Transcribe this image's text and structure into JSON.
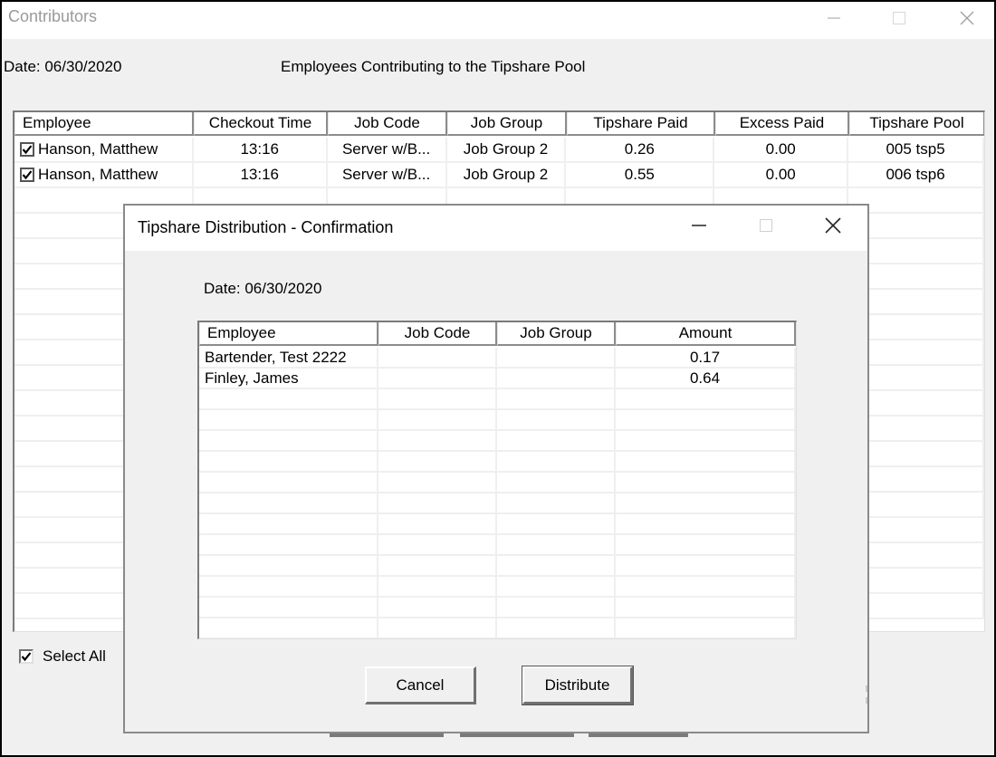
{
  "main_window": {
    "title": "Contributors",
    "date_label": "Date: 06/30/2020",
    "heading": "Employees Contributing to the Tipshare Pool",
    "controls": {
      "minimize": "minimize-icon",
      "maximize": "maximize-icon",
      "close": "close-icon"
    },
    "grid": {
      "columns": [
        "Employee",
        "Checkout Time",
        "Job Code",
        "Job Group",
        "Tipshare Paid",
        "Excess Paid",
        "Tipshare Pool"
      ],
      "rows": [
        {
          "checked": true,
          "employee": "Hanson, Matthew",
          "checkout_time": "13:16",
          "job_code": "Server w/B...",
          "job_group": "Job Group 2",
          "tipshare_paid": "0.26",
          "excess_paid": "0.00",
          "tipshare_pool": "005 tsp5"
        },
        {
          "checked": true,
          "employee": "Hanson, Matthew",
          "checkout_time": "13:16",
          "job_code": "Server w/B...",
          "job_group": "Job Group 2",
          "tipshare_paid": "0.55",
          "excess_paid": "0.00",
          "tipshare_pool": "006 tsp6"
        }
      ]
    },
    "select_all": {
      "label": "Select All",
      "checked": true
    }
  },
  "dialog": {
    "title": "Tipshare Distribution - Confirmation",
    "date_label": "Date: 06/30/2020",
    "controls": {
      "minimize": "minimize-icon",
      "maximize": "maximize-icon",
      "close": "close-icon"
    },
    "grid": {
      "columns": [
        "Employee",
        "Job Code",
        "Job Group",
        "Amount"
      ],
      "rows": [
        {
          "employee": "Bartender, Test 2222",
          "job_code": "",
          "job_group": "",
          "amount": "0.17"
        },
        {
          "employee": "Finley, James",
          "job_code": "",
          "job_group": "",
          "amount": "0.64"
        }
      ]
    },
    "buttons": {
      "cancel": "Cancel",
      "distribute": "Distribute"
    }
  }
}
